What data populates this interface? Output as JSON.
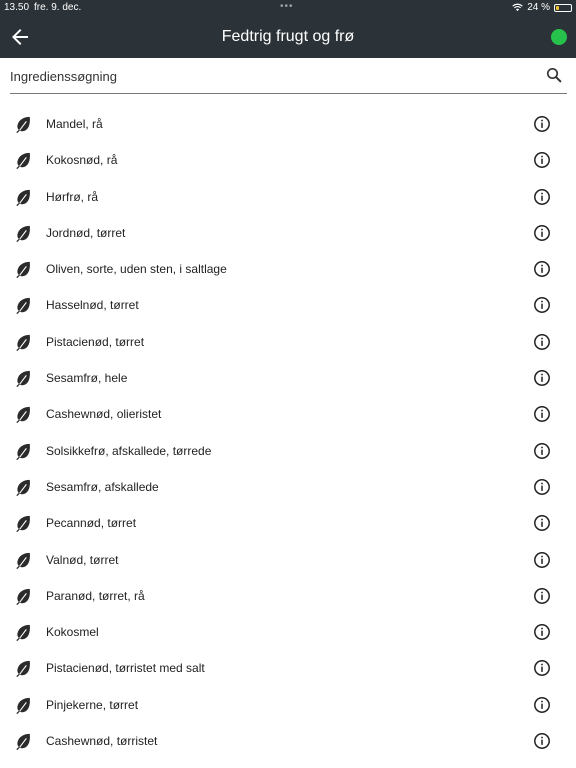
{
  "status_bar": {
    "time": "13.50",
    "date": "fre. 9. dec.",
    "dots": "•••",
    "battery_text": "24 %",
    "battery_level": 0.24,
    "battery_color": "#f2c230"
  },
  "app_bar": {
    "title": "Fedtrig frugt og frø",
    "back_icon": "arrow-left-icon",
    "status_dot_color": "#27c24c"
  },
  "search": {
    "placeholder": "Ingredienssøgning",
    "icon": "search-icon"
  },
  "items": [
    {
      "label": "Mandel, rå"
    },
    {
      "label": "Kokosnød, rå"
    },
    {
      "label": "Hørfrø, rå"
    },
    {
      "label": "Jordnød, tørret"
    },
    {
      "label": "Oliven, sorte, uden sten, i saltlage"
    },
    {
      "label": "Hasselnød, tørret"
    },
    {
      "label": "Pistacienød, tørret"
    },
    {
      "label": "Sesamfrø, hele"
    },
    {
      "label": "Cashewnød, olieristet"
    },
    {
      "label": "Solsikkefrø, afskallede, tørrede"
    },
    {
      "label": "Sesamfrø, afskallede"
    },
    {
      "label": "Pecannød, tørret"
    },
    {
      "label": "Valnød, tørret"
    },
    {
      "label": "Paranød, tørret, rå"
    },
    {
      "label": "Kokosmel"
    },
    {
      "label": "Pistacienød, tørristet med salt"
    },
    {
      "label": "Pinjekerne, tørret"
    },
    {
      "label": "Cashewnød, tørristet"
    }
  ]
}
